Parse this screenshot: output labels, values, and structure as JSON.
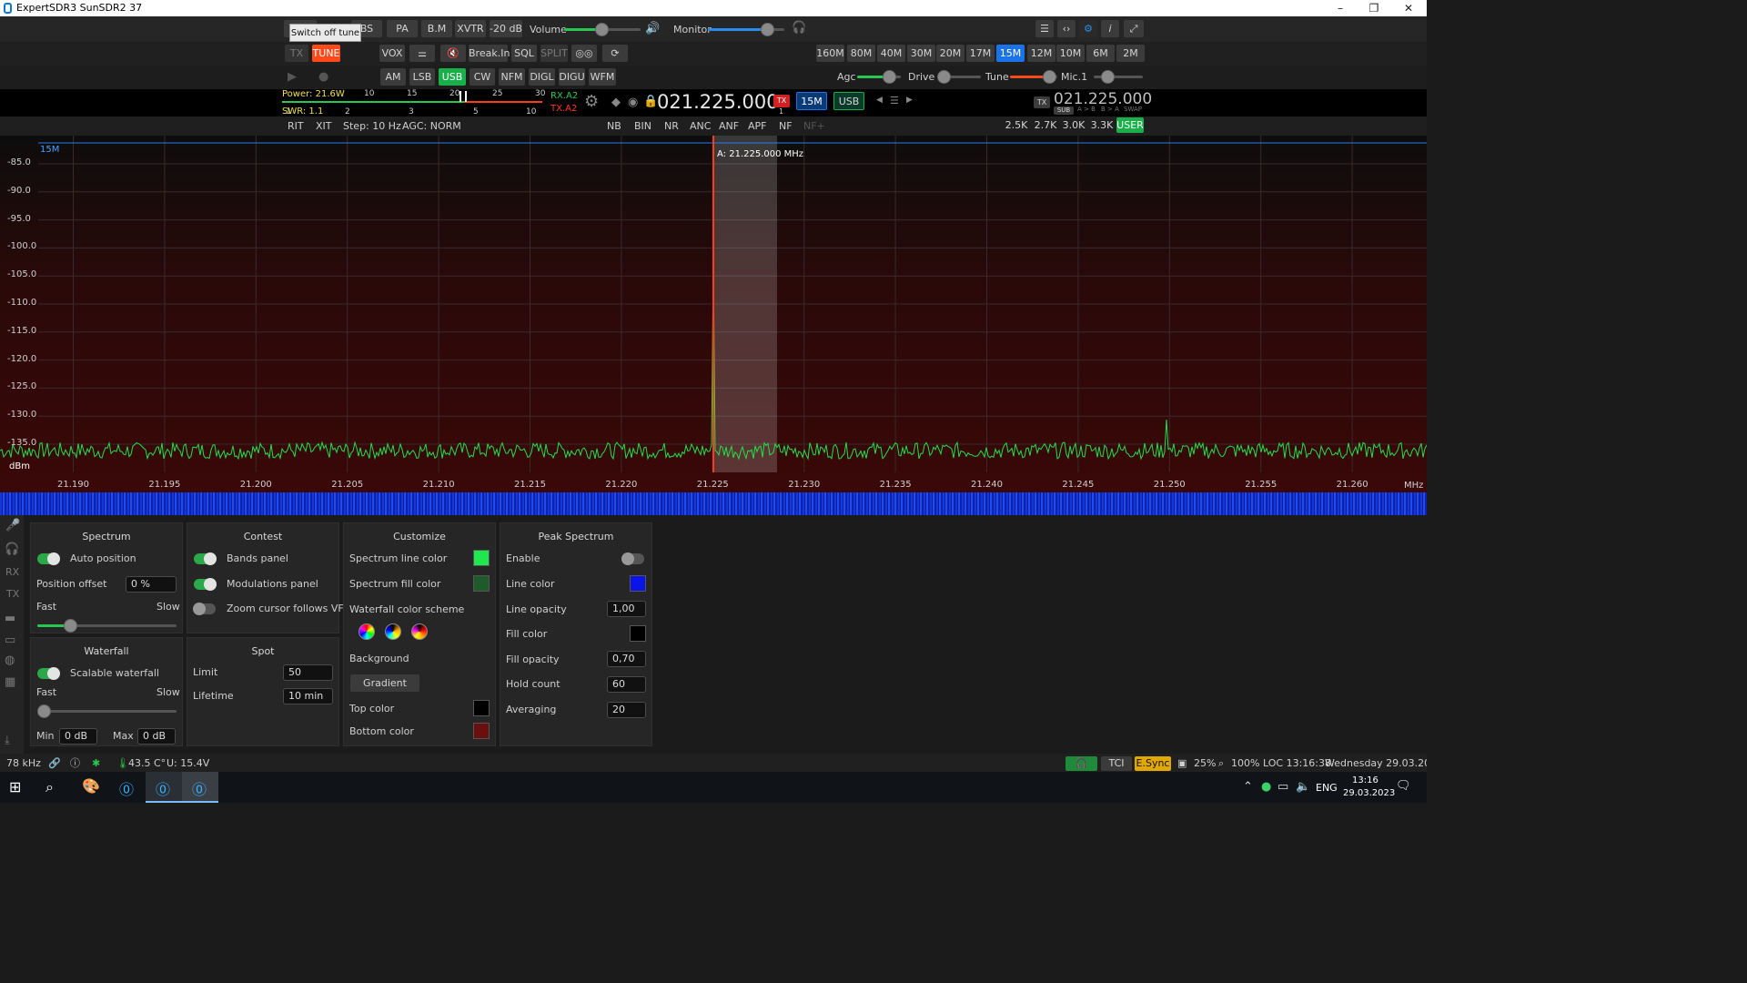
{
  "window": {
    "title": "ExpertSDR3 SunSDR2 37",
    "minimize": "–",
    "maximize": "❐",
    "close": "✕"
  },
  "tooltip": "Switch off tune",
  "row1": {
    "buttons": [
      "BS",
      "PA",
      "B.M",
      "XVTR",
      "-20 dB"
    ],
    "volume_label": "Volume",
    "monitor_label": "Monitor",
    "volume_level": 0.78,
    "monitor_level": 0.75
  },
  "row2": {
    "tx": "TX",
    "tune": "TUNE",
    "vox": "VOX",
    "breakin": "Break.In",
    "sql": "SQL",
    "split": "SPLIT",
    "bands": [
      "160M",
      "80M",
      "40M",
      "30M",
      "20M",
      "17M",
      "15M",
      "12M",
      "10M",
      "6M",
      "2M"
    ],
    "active_band": "15M"
  },
  "row3": {
    "modes": [
      "AM",
      "LSB",
      "USB",
      "CW",
      "NFM",
      "DIGL",
      "DIGU",
      "WFM"
    ],
    "active_mode": "USB",
    "agc": "Agc",
    "drive": "Drive",
    "tune": "Tune",
    "mic": "Mic.1"
  },
  "meter": {
    "power": "Power: 21.6W",
    "swr": "SWR: 1.1",
    "scale_top": [
      "10",
      "15",
      "20",
      "25",
      "30"
    ],
    "scale_bottom": [
      "1",
      "2",
      "3",
      "5",
      "10"
    ],
    "rx": "RX.A2",
    "tx": "TX.A2"
  },
  "vfo_a": {
    "freq": "021.225.000",
    "tx_badge": "TX",
    "band": "15M",
    "mode": "USB",
    "num": "1"
  },
  "vfo_b": {
    "freq": "021.225.000",
    "tx_badge": "TX",
    "sub": "SUB",
    "ab": "A > B",
    "ba": "B > A",
    "swap": "SWAP"
  },
  "row5": {
    "rit": "RIT",
    "xit": "XIT",
    "step": "Step: 10 Hz",
    "agc": "AGC: NORM",
    "filters_dsp": [
      "NB",
      "BIN",
      "NR",
      "ANC",
      "ANF",
      "APF",
      "NF",
      "NF+"
    ],
    "bandwidths": [
      "2.5K",
      "2.7K",
      "3.0K",
      "3.3K",
      "USER"
    ],
    "active_bw": "USER"
  },
  "spectrum": {
    "band_label": "15M",
    "cursor_label": "A: 21.225.000 MHz",
    "y_labels": [
      "-85.0",
      "-90.0",
      "-95.0",
      "-100.0",
      "-105.0",
      "-110.0",
      "-115.0",
      "-120.0",
      "-125.0",
      "-130.0",
      "-135.0"
    ],
    "y_unit": "dBm",
    "x_labels": [
      "21.190",
      "21.195",
      "21.200",
      "21.205",
      "21.210",
      "21.215",
      "21.220",
      "21.225",
      "21.230",
      "21.235",
      "21.240",
      "21.245",
      "21.250",
      "21.255",
      "21.260"
    ],
    "x_unit": "MHz",
    "colors": {
      "line": "#22e04a",
      "cursor": "#ff3b1a",
      "filter": "#ffffff"
    }
  },
  "panels": {
    "spectrum": {
      "title": "Spectrum",
      "auto_position": "Auto position",
      "position_offset": "Position offset",
      "offset_value": "0 %",
      "fast": "Fast",
      "slow": "Slow",
      "speed": 0.24
    },
    "waterfall": {
      "title": "Waterfall",
      "scalable": "Scalable waterfall",
      "fast": "Fast",
      "slow": "Slow",
      "min": "Min",
      "min_value": "0 dB",
      "max": "Max",
      "max_value": "0 dB",
      "speed": 0.05
    },
    "contest": {
      "title": "Contest",
      "bands_panel": "Bands panel",
      "modulations_panel": "Modulations panel",
      "zoom_cursor": "Zoom cursor follows VFO"
    },
    "spot": {
      "title": "Spot",
      "limit": "Limit",
      "limit_value": "50",
      "lifetime": "Lifetime",
      "lifetime_value": "10 min"
    },
    "customize": {
      "title": "Customize",
      "line_color": "Spectrum line color",
      "fill_color": "Spectrum fill color",
      "scheme": "Waterfall color scheme",
      "background": "Background",
      "gradient": "Gradient",
      "top_color": "Top color",
      "bottom_color": "Bottom color",
      "swatches": {
        "line": "#1ee84b",
        "fill": "#1f5a2a",
        "top": "#000000",
        "bottom": "#6a0f0f"
      }
    },
    "peak": {
      "title": "Peak Spectrum",
      "enable": "Enable",
      "line_color": "Line color",
      "line_opacity": "Line opacity",
      "line_opacity_value": "1,00",
      "fill_color": "Fill color",
      "fill_opacity": "Fill opacity",
      "fill_opacity_value": "0,70",
      "hold_count": "Hold count",
      "hold_count_value": "60",
      "averaging": "Averaging",
      "averaging_value": "20",
      "swatches": {
        "line": "#0a14e8",
        "fill": "#000000"
      }
    }
  },
  "sidebar": [
    "RX",
    "TX"
  ],
  "statusbar": {
    "khz": "78 kHz",
    "temp": "43.5 C°",
    "voltage": "U: 15.4V",
    "tci": "TCI",
    "esync": "E.Sync",
    "cpu": "25%",
    "zoom": "100%",
    "loc": "LOC 13:16:38",
    "date": "Wednesday 29.03.2023"
  },
  "taskbar": {
    "lang": "ENG",
    "time": "13:16",
    "date": "29.03.2023"
  }
}
